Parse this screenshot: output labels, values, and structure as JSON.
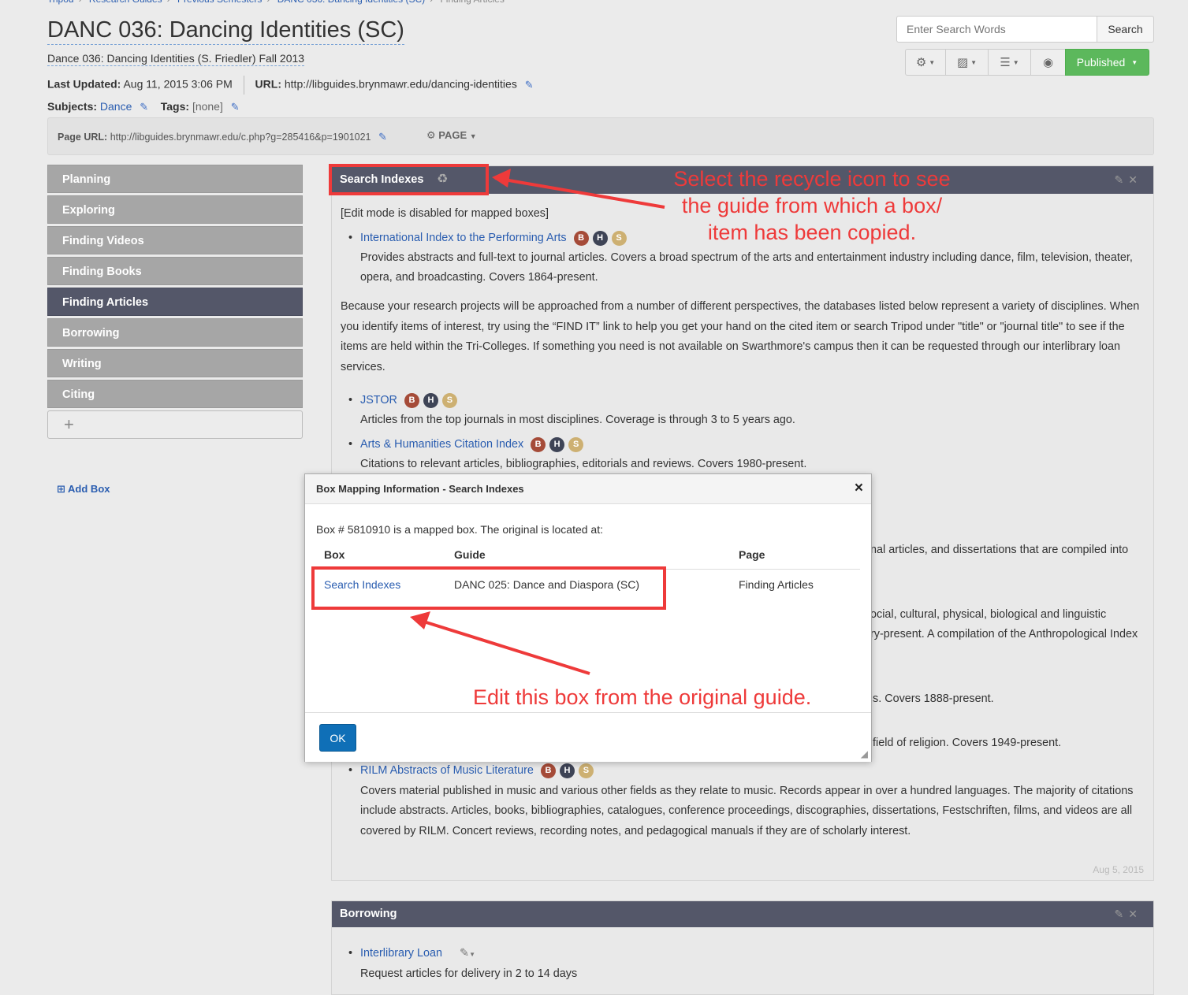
{
  "guide": {
    "title": "DANC 036: Dancing Identities (SC)",
    "subtitle": "Dance 036: Dancing Identities (S. Friedler) Fall 2013",
    "last_updated_label": "Last Updated:",
    "last_updated_value": "Aug 11, 2015 3:06 PM",
    "url_label": "URL:",
    "url_value": "http://libguides.brynmawr.edu/dancing-identities",
    "subjects_label": "Subjects:",
    "subjects_value": "Dance",
    "tags_label": "Tags:",
    "tags_value": "[none]",
    "page_url_label": "Page URL:",
    "page_url_value": "http://libguides.brynmawr.edu/c.php?g=285416&p=1901021",
    "page_menu": "PAGE"
  },
  "search": {
    "placeholder": "Enter Search Words",
    "button": "Search"
  },
  "toolbar": {
    "published": "Published"
  },
  "nav": {
    "items": [
      "Planning",
      "Exploring",
      "Finding Videos",
      "Finding Books",
      "Finding Articles",
      "Borrowing",
      "Writing",
      "Citing"
    ],
    "add": "+",
    "add_box": "Add Box"
  },
  "box": {
    "title": "Search Indexes",
    "edit_notice": "[Edit mode is disabled for mapped boxes]",
    "item1_title": "International Index to the Performing Arts",
    "item1_desc": "Provides abstracts and full-text to journal articles. Covers a broad spectrum of the arts and entertainment industry including dance, film, television, theater, opera, and broadcasting. Covers 1864-present.",
    "para": "Because your research projects will be approached from a number of different perspectives, the databases listed below represent a variety of disciplines. When you identify items of interest, try using the “FIND IT” link to help you get your hand on the cited item or search Tripod under \"title\" or \"journal title\" to see if the items are held within the Tri-Colleges.  If something you need is not available on Swarthmore's campus then it can be requested through our interlibrary loan services.",
    "item2_title": "JSTOR",
    "item2_desc": "Articles from the top journals in most disciplines. Coverage is through 3 to 5 years ago.",
    "item3_title": "Arts & Humanities Citation Index",
    "item3_desc": "Citations to relevant articles, bibliographies, editorials and reviews. Covers 1980-present.",
    "frag1": "nal articles, and dissertations that are compiled into",
    "frag2a": "ocial, cultural, physical, biological and linguistic",
    "frag2b": "ry-present. A compilation of the Anthropological Index",
    "frag3": "s. Covers 1888-present.",
    "frag4": "field of religion. Covers 1949-present.",
    "item_last_title": "RILM Abstracts of Music Literature",
    "item_last_desc": "Covers material published in music and various other fields as they relate to music. Records appear in over a hundred languages. The majority of citations include abstracts. Articles, books, bibliographies, catalogues, conference proceedings, discographies, dissertations, Festschriften, films, and videos are all covered by RILM. Concert reviews, recording notes, and pedagogical manuals if they are of scholarly interest.",
    "footer_date": "Aug 5, 2015",
    "badges": [
      "B",
      "H",
      "S"
    ]
  },
  "box2": {
    "title": "Borrowing",
    "item1_title": "Interlibrary Loan",
    "item1_desc": "Request articles for delivery in 2 to 14 days"
  },
  "modal": {
    "title": "Box Mapping Information - Search Indexes",
    "info": "Box # 5810910 is a mapped box. The original is located at:",
    "col_box": "Box",
    "col_guide": "Guide",
    "col_page": "Page",
    "row_box": "Search Indexes",
    "row_guide": "DANC 025: Dance and Diaspora (SC)",
    "row_page": "Finding Articles",
    "ok": "OK",
    "close": "×"
  },
  "annotations": {
    "top_note_1": "Select the recycle icon to see",
    "top_note_2": "the guide from which a box/",
    "top_note_3": "item has been copied.",
    "bottom_note": "Edit this box from the original guide.",
    "color": "#ee3a3a"
  }
}
